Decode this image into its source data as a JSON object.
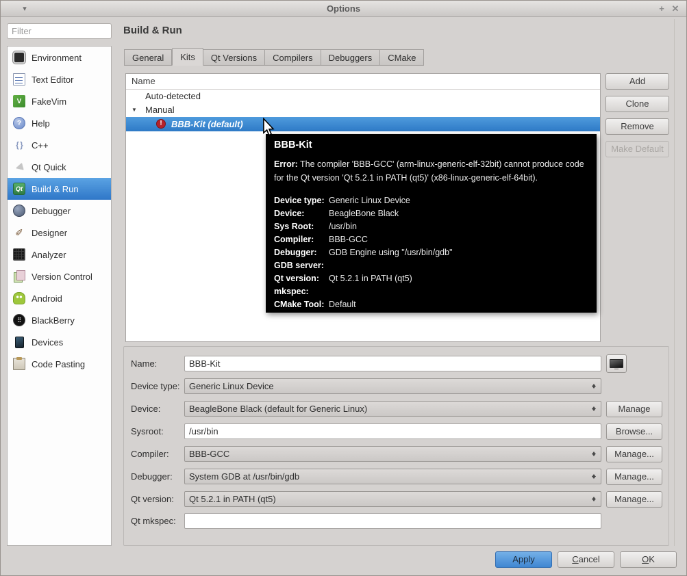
{
  "window": {
    "title": "Options",
    "menu_glyph": "▾",
    "maximize_glyph": "+",
    "close_glyph": "✕"
  },
  "sidebar": {
    "filter_placeholder": "Filter",
    "items": [
      {
        "label": "Environment",
        "icon": "environment-icon"
      },
      {
        "label": "Text Editor",
        "icon": "text-editor-icon"
      },
      {
        "label": "FakeVim",
        "icon": "fakevim-icon"
      },
      {
        "label": "Help",
        "icon": "help-icon"
      },
      {
        "label": "C++",
        "icon": "cpp-icon"
      },
      {
        "label": "Qt Quick",
        "icon": "qt-quick-icon"
      },
      {
        "label": "Build & Run",
        "icon": "build-run-icon",
        "selected": true
      },
      {
        "label": "Debugger",
        "icon": "debugger-icon"
      },
      {
        "label": "Designer",
        "icon": "designer-icon"
      },
      {
        "label": "Analyzer",
        "icon": "analyzer-icon"
      },
      {
        "label": "Version Control",
        "icon": "version-control-icon"
      },
      {
        "label": "Android",
        "icon": "android-icon"
      },
      {
        "label": "BlackBerry",
        "icon": "blackberry-icon"
      },
      {
        "label": "Devices",
        "icon": "devices-icon"
      },
      {
        "label": "Code Pasting",
        "icon": "code-pasting-icon"
      }
    ]
  },
  "page": {
    "title": "Build & Run"
  },
  "tabs": [
    {
      "label": "General"
    },
    {
      "label": "Kits",
      "active": true
    },
    {
      "label": "Qt Versions"
    },
    {
      "label": "Compilers"
    },
    {
      "label": "Debuggers"
    },
    {
      "label": "CMake"
    }
  ],
  "kits": {
    "column_header": "Name",
    "tree": {
      "auto_detected": "Auto-detected",
      "manual": "Manual",
      "selected_kit": "BBB-Kit (default)",
      "error_glyph": "!"
    },
    "actions": {
      "add": "Add",
      "clone": "Clone",
      "remove": "Remove",
      "make_default": "Make Default"
    }
  },
  "tooltip": {
    "title": "BBB-Kit",
    "error_label": "Error:",
    "error_text": " The compiler 'BBB-GCC' (arm-linux-generic-elf-32bit) cannot produce code for the Qt version 'Qt 5.2.1 in PATH (qt5)' (x86-linux-generic-elf-64bit).",
    "rows": [
      {
        "label": "Device type:",
        "value": "Generic Linux Device"
      },
      {
        "label": "Device:",
        "value": "BeagleBone Black"
      },
      {
        "label": "Sys Root:",
        "value": "/usr/bin"
      },
      {
        "label": "Compiler:",
        "value": "BBB-GCC"
      },
      {
        "label": "Debugger:",
        "value": "GDB Engine using \"/usr/bin/gdb\""
      },
      {
        "label": "GDB server:",
        "value": ""
      },
      {
        "label": "Qt version:",
        "value": "Qt 5.2.1 in PATH (qt5)"
      },
      {
        "label": "mkspec:",
        "value": ""
      },
      {
        "label": "CMake Tool:",
        "value": "Default"
      }
    ]
  },
  "form": {
    "name": {
      "label": "Name:",
      "value": "BBB-Kit"
    },
    "device_type": {
      "label": "Device type:",
      "value": "Generic Linux Device"
    },
    "device": {
      "label": "Device:",
      "value": "BeagleBone Black (default for Generic Linux)",
      "action": "Manage"
    },
    "sysroot": {
      "label": "Sysroot:",
      "value": "/usr/bin",
      "action": "Browse..."
    },
    "compiler": {
      "label": "Compiler:",
      "value": "BBB-GCC",
      "action": "Manage..."
    },
    "debugger": {
      "label": "Debugger:",
      "value": "System GDB at /usr/bin/gdb",
      "action": "Manage..."
    },
    "qt_version": {
      "label": "Qt version:",
      "value": "Qt 5.2.1 in PATH (qt5)",
      "action": "Manage..."
    },
    "qt_mkspec": {
      "label": "Qt mkspec:",
      "value": ""
    }
  },
  "footer": {
    "apply": "Apply",
    "cancel": "Cancel",
    "ok": "OK"
  },
  "colors": {
    "selection_blue": "#3b82cd",
    "apply_blue": "#4f93da",
    "tooltip_bg": "#000000",
    "error_red": "#b5232b"
  }
}
